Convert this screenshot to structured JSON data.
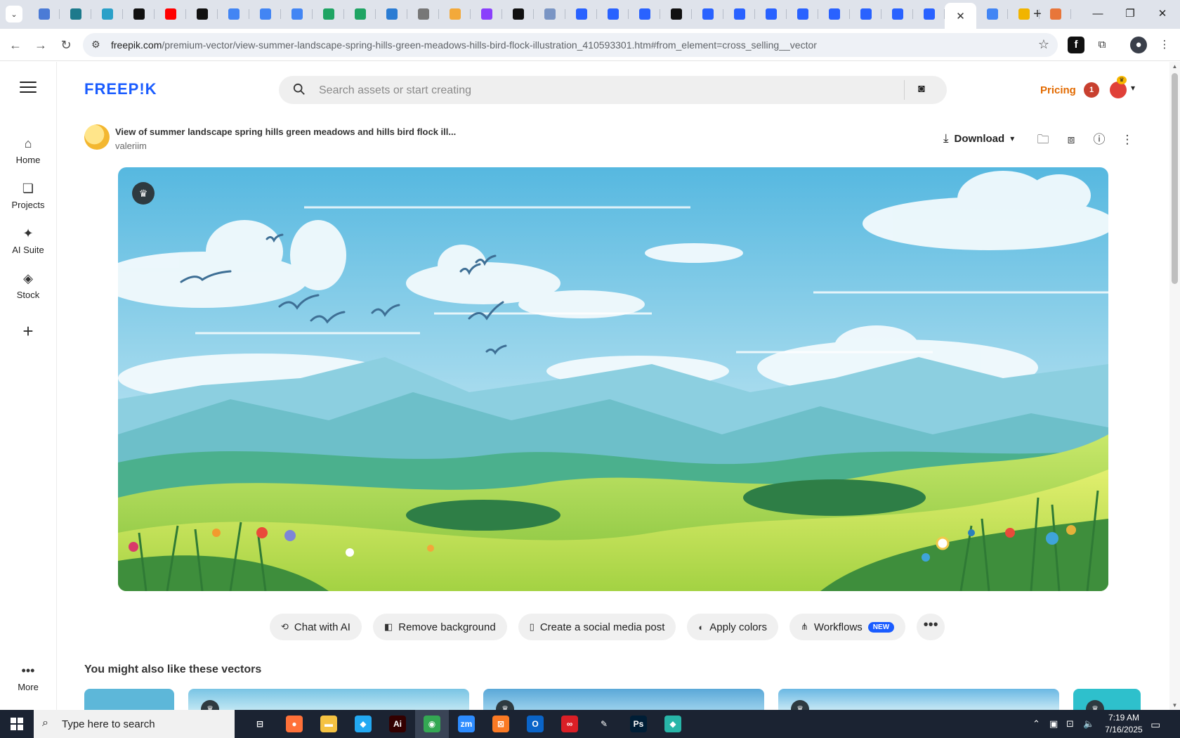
{
  "browser": {
    "tabs": [
      {
        "icon": "globe-icon",
        "color": "#4b7bd6"
      },
      {
        "icon": "web-icon",
        "color": "#1d7a8c"
      },
      {
        "icon": "app-icon",
        "color": "#2aa0c8"
      },
      {
        "icon": "openai-icon",
        "color": "#111111"
      },
      {
        "icon": "youtube-icon",
        "color": "#ff0000"
      },
      {
        "icon": "bolt-icon",
        "color": "#111111"
      },
      {
        "icon": "docs-icon",
        "color": "#4285f4"
      },
      {
        "icon": "docs-icon",
        "color": "#4285f4"
      },
      {
        "icon": "docs-icon",
        "color": "#4285f4"
      },
      {
        "icon": "sheets-icon",
        "color": "#1fa463"
      },
      {
        "icon": "sheets-icon",
        "color": "#1fa463"
      },
      {
        "icon": "word-icon",
        "color": "#2b7cd3"
      },
      {
        "icon": "globe-icon",
        "color": "#777777"
      },
      {
        "icon": "v-icon",
        "color": "#f3a93a"
      },
      {
        "icon": "code-icon",
        "color": "#8a3ffc"
      },
      {
        "icon": "a-icon",
        "color": "#111111"
      },
      {
        "icon": "grid-icon",
        "color": "#7a95c4"
      },
      {
        "icon": "form-icon",
        "color": "#2962ff"
      },
      {
        "icon": "form-icon",
        "color": "#2962ff"
      },
      {
        "icon": "form-icon",
        "color": "#2962ff"
      },
      {
        "icon": "m-icon",
        "color": "#111111"
      },
      {
        "icon": "form-icon",
        "color": "#2962ff"
      },
      {
        "icon": "form-icon",
        "color": "#2962ff"
      },
      {
        "icon": "form-icon",
        "color": "#2962ff"
      },
      {
        "icon": "form-icon",
        "color": "#2962ff"
      },
      {
        "icon": "form-icon",
        "color": "#2962ff"
      },
      {
        "icon": "form-icon",
        "color": "#2962ff"
      },
      {
        "icon": "form-icon",
        "color": "#2962ff"
      },
      {
        "icon": "form-icon",
        "color": "#2962ff"
      }
    ],
    "active_tab_close": "✕",
    "extra_tabs": [
      {
        "icon": "google-icon",
        "color": "#4285f4"
      },
      {
        "icon": "hat-icon",
        "color": "#f1b400"
      },
      {
        "icon": "hand-icon",
        "color": "#e8763a"
      }
    ],
    "url_host": "freepik.com",
    "url_path": "/premium-vector/view-summer-landscape-spring-hills-green-meadows-hills-bird-flock-illustration_410593301.htm#from_element=cross_selling__vector"
  },
  "rail": {
    "items": [
      {
        "label": "Home",
        "icon": "home-icon"
      },
      {
        "label": "Projects",
        "icon": "projects-icon"
      },
      {
        "label": "AI Suite",
        "icon": "sparkle-icon"
      },
      {
        "label": "Stock",
        "icon": "stock-icon"
      }
    ],
    "more_label": "More"
  },
  "header": {
    "logo": "FREEP!K",
    "search_placeholder": "Search assets or start creating",
    "pricing": "Pricing",
    "notification_count": "1"
  },
  "asset": {
    "title": "View of summer landscape spring hills green meadows and hills bird flock ill...",
    "author": "valeriim",
    "download_label": "Download"
  },
  "chips": [
    {
      "label": "Chat with AI",
      "icon": "chat-icon"
    },
    {
      "label": "Remove background",
      "icon": "remove-bg-icon"
    },
    {
      "label": "Create a social media post",
      "icon": "phone-icon"
    },
    {
      "label": "Apply colors",
      "icon": "palette-icon"
    },
    {
      "label": "Workflows",
      "icon": "workflow-icon",
      "badge": "NEW"
    }
  ],
  "related": {
    "title": "You might also like these vectors"
  },
  "taskbar": {
    "search_placeholder": "Type here to search",
    "time": "7:19 AM",
    "date": "7/16/2025",
    "apps": [
      {
        "icon": "task-view-icon",
        "color": "#1b2332",
        "glyph": "⊟"
      },
      {
        "icon": "firefox-icon",
        "color": "#ff7139",
        "glyph": "●"
      },
      {
        "icon": "explorer-icon",
        "color": "#f5c242",
        "glyph": "▬"
      },
      {
        "icon": "vscode-icon",
        "color": "#23a9f2",
        "glyph": "◆"
      },
      {
        "icon": "illustrator-icon",
        "color": "#330000",
        "glyph": "Ai"
      },
      {
        "icon": "chrome-icon",
        "color": "#34a853",
        "glyph": "◉"
      },
      {
        "icon": "zoom-icon",
        "color": "#2d8cff",
        "glyph": "zm"
      },
      {
        "icon": "xampp-icon",
        "color": "#fb7a24",
        "glyph": "⊠"
      },
      {
        "icon": "outlook-icon",
        "color": "#0a64c8",
        "glyph": "O"
      },
      {
        "icon": "creative-cloud-icon",
        "color": "#da1f26",
        "glyph": "∞"
      },
      {
        "icon": "pen-tool-icon",
        "color": "#1b2332",
        "glyph": "✎"
      },
      {
        "icon": "photoshop-icon",
        "color": "#001e36",
        "glyph": "Ps"
      },
      {
        "icon": "app-icon",
        "color": "#28b5a8",
        "glyph": "◆"
      }
    ]
  }
}
